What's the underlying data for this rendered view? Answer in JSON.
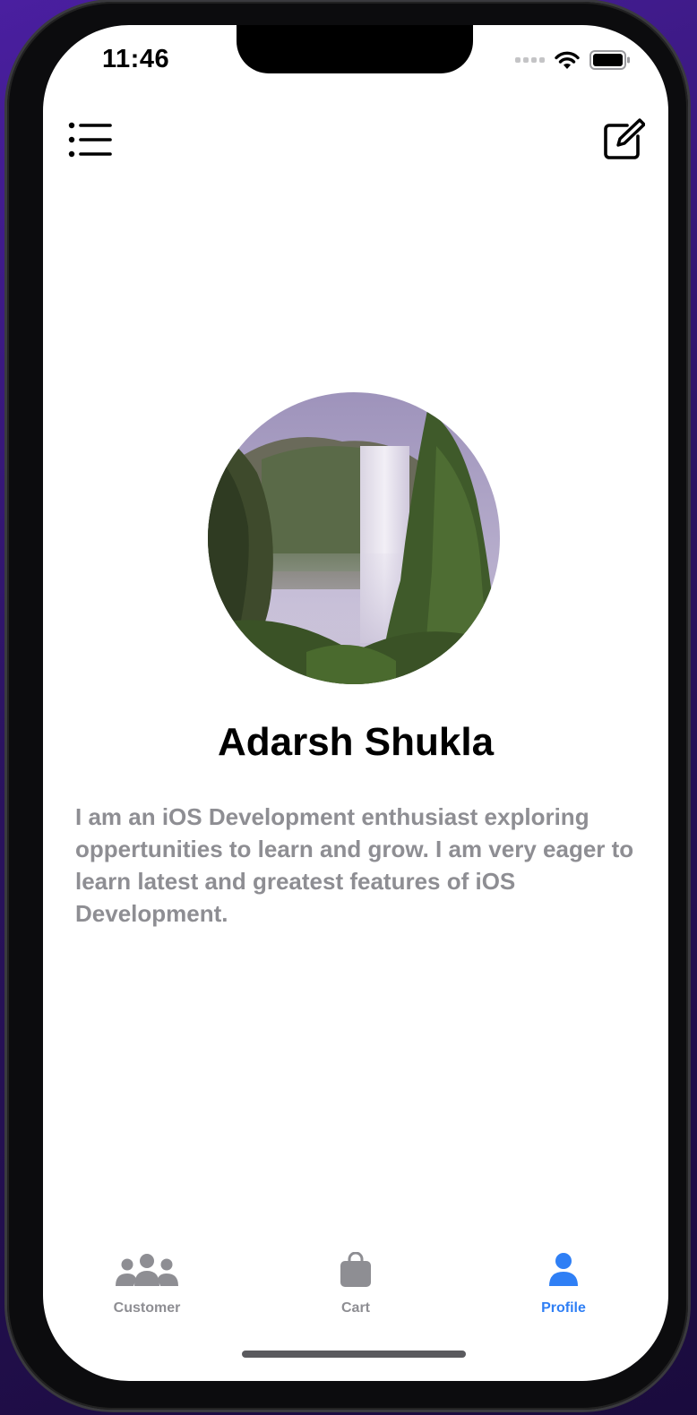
{
  "status_bar": {
    "time": "11:46",
    "wifi_icon": "wifi-icon",
    "battery_icon": "battery-icon"
  },
  "header": {
    "menu_icon": "list-menu-icon",
    "edit_icon": "compose-edit-icon"
  },
  "profile": {
    "avatar_icon": "waterfall-avatar-image",
    "name": "Adarsh Shukla",
    "bio": "I am an iOS Development enthusiast exploring oppertunities to learn and grow. I am very eager to learn latest and greatest features of iOS Development."
  },
  "tab_bar": {
    "active_tab": "Profile",
    "items": [
      {
        "label": "Customer",
        "icon": "people-icon"
      },
      {
        "label": "Cart",
        "icon": "bag-icon"
      },
      {
        "label": "Profile",
        "icon": "person-icon"
      }
    ]
  },
  "colors": {
    "accent": "#2f7ff5",
    "secondary_text": "#8e8e93",
    "background": "#ffffff"
  }
}
